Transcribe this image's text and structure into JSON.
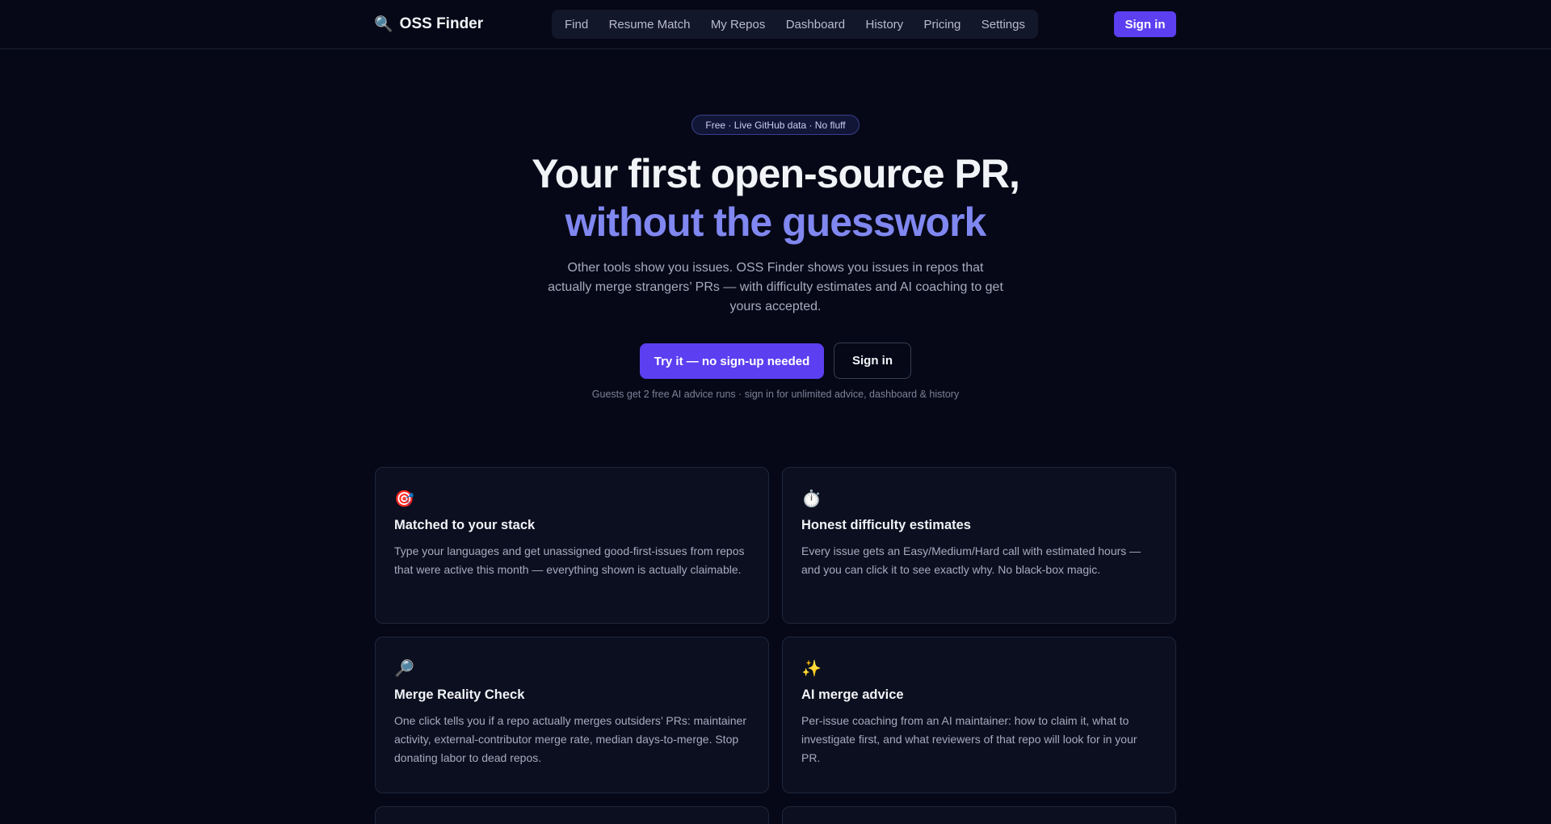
{
  "header": {
    "brand": "OSS Finder",
    "nav": [
      "Find",
      "Resume Match",
      "My Repos",
      "Dashboard",
      "History",
      "Pricing",
      "Settings"
    ],
    "signin": "Sign in"
  },
  "hero": {
    "badge": "Free · Live GitHub data · No fluff",
    "title": "Your first open-source PR,",
    "accent": "without the guesswork",
    "subtitle": "Other tools show you issues. OSS Finder shows you issues in repos that actually merge strangers’ PRs — with difficulty estimates and AI coaching to get yours accepted.",
    "cta_primary": "Try it — no sign-up needed",
    "cta_secondary": "Sign in",
    "note": "Guests get 2 free AI advice runs · sign in for unlimited advice, dashboard & history"
  },
  "features": [
    {
      "icon": "🎯",
      "title": "Matched to your stack",
      "desc": "Type your languages and get unassigned good-first-issues from repos that were active this month — everything shown is actually claimable."
    },
    {
      "icon": "⏱️",
      "title": "Honest difficulty estimates",
      "desc": "Every issue gets an Easy/Medium/Hard call with estimated hours — and you can click it to see exactly why. No black-box magic."
    },
    {
      "icon": "🔎",
      "title": "Merge Reality Check",
      "desc": "One click tells you if a repo actually merges outsiders’ PRs: maintainer activity, external-contributor merge rate, median days-to-merge. Stop donating labor to dead repos."
    },
    {
      "icon": "✨",
      "title": "AI merge advice",
      "desc": "Per-issue coaching from an AI maintainer: how to claim it, what to investigate first, and what reviewers of that repo will look for in your PR."
    },
    {
      "icon": "",
      "title": "",
      "desc": ""
    },
    {
      "icon": "",
      "title": "",
      "desc": ""
    }
  ]
}
